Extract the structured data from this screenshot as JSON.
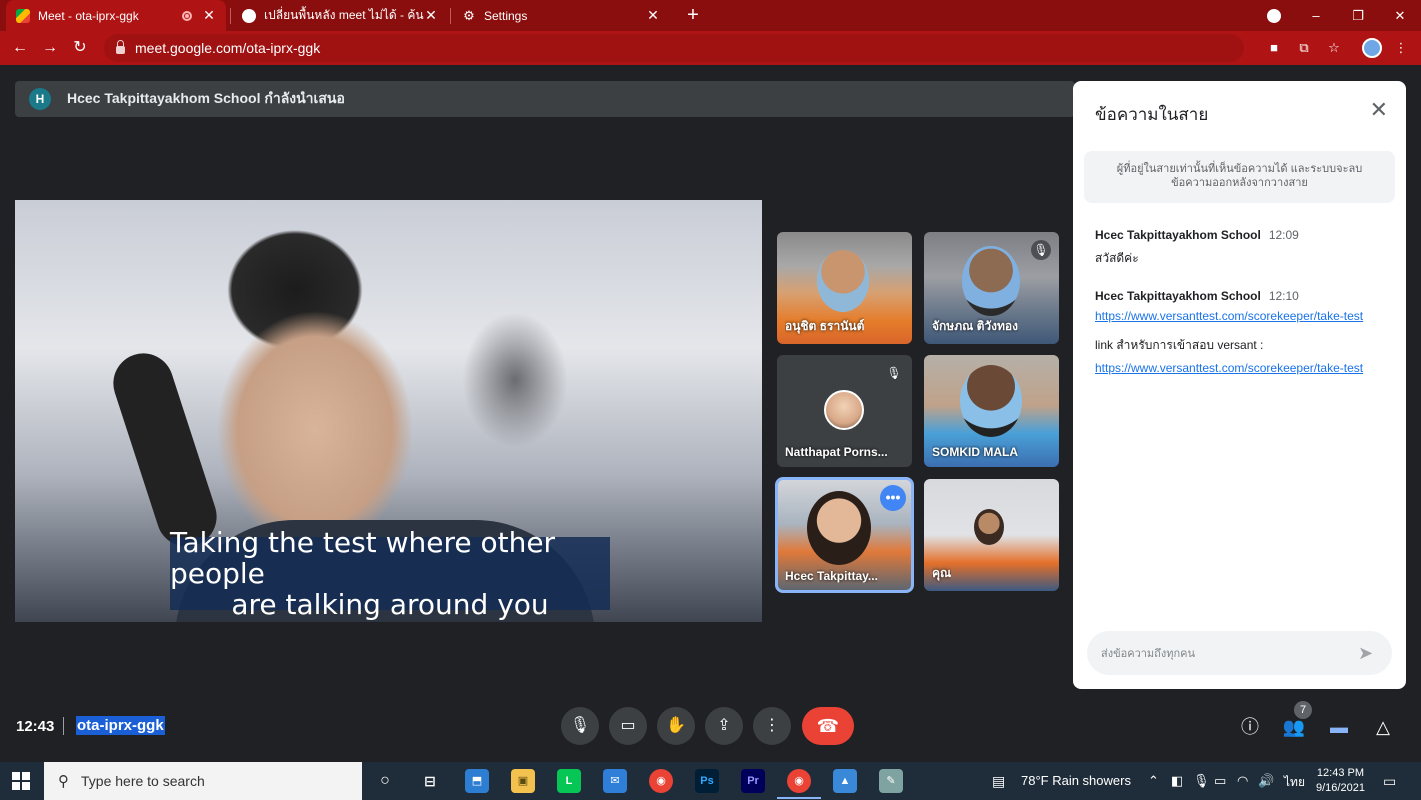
{
  "browser": {
    "tabs": [
      {
        "label": "Meet - ota-iprx-ggk",
        "active": true
      },
      {
        "label": "เปลี่ยนพื้นหลัง meet ไม่ได้ - ค้นหาด้วย",
        "active": false
      },
      {
        "label": "Settings",
        "active": false
      }
    ],
    "new_tab": "+",
    "url": "meet.google.com/ota-iprx-ggk",
    "window_controls": [
      "–",
      "❐",
      "✕"
    ]
  },
  "meet": {
    "presenter_initial": "H",
    "presenting_text": "Hcec Takpittayakhom School กำลังนำเสนอ",
    "caption_lines": [
      "Taking the test where other people",
      "are talking around you"
    ],
    "participants": [
      {
        "name": "อนุชิต ธรานันต์",
        "muted": false
      },
      {
        "name": "จักษภณ ติวังทอง",
        "muted": true
      },
      {
        "name": "Natthapat Porns...",
        "muted": true
      },
      {
        "name": "SOMKID MALA",
        "muted": false
      },
      {
        "name": "Hcec Takpittay...",
        "muted": false,
        "active_speaker": true
      },
      {
        "name": "คุณ",
        "muted": false
      }
    ],
    "more_options": "•••"
  },
  "chat": {
    "title": "ข้อความในสาย",
    "notice": "ผู้ที่อยู่ในสายเท่านั้นที่เห็นข้อความได้ และระบบจะลบข้อความออกหลังจากวางสาย",
    "messages": [
      {
        "sender": "Hcec Takpittayakhom School",
        "time": "12:09",
        "text": "สวัสดีค่ะ"
      },
      {
        "sender": "Hcec Takpittayakhom School",
        "time": "12:10",
        "link1": "https://www.versanttest.com/scorekeeper/take-test",
        "text": "link สำหรับการเข้าสอบ versant :",
        "link2": "https://www.versanttest.com/scorekeeper/take-test"
      }
    ],
    "input_placeholder": "ส่งข้อความถึงทุกคน"
  },
  "controls": {
    "clock": "12:43",
    "meeting_code": "ota-iprx-ggk",
    "people_count": "7"
  },
  "taskbar": {
    "search_placeholder": "Type here to search",
    "weather": "78°F  Rain showers",
    "language": "ไทย",
    "time": "12:43 PM",
    "date": "9/16/2021"
  },
  "colors": {
    "chrome_tabbar": "#8b0e0e",
    "chrome_toolbar": "#b01313",
    "meet_bg": "#202124",
    "end_call": "#ea4335",
    "link": "#1a73e8"
  }
}
